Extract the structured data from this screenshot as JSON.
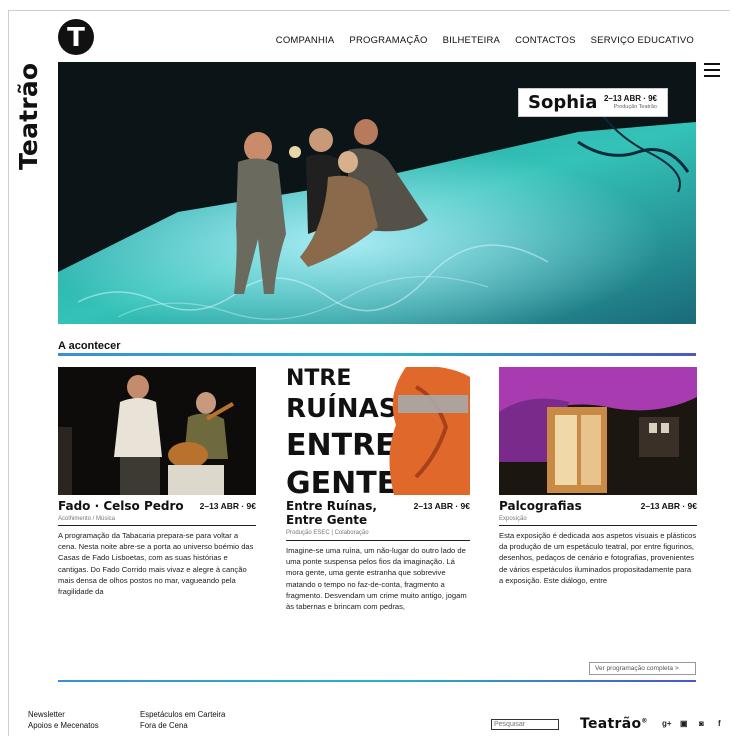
{
  "brand": {
    "name": "Teatrão",
    "logo_letter": "T"
  },
  "nav": {
    "items": [
      "COMPANHIA",
      "PROGRAMAÇÃO",
      "BILHETEIRA",
      "CONTACTOS",
      "SERVIÇO EDUCATIVO"
    ]
  },
  "menu_icon": "hamburger-menu-icon",
  "hero": {
    "title": "Sophia",
    "date": "2–13 ABR · 9€",
    "subtitle": "Produção Teatrão"
  },
  "section": {
    "title": "A acontecer"
  },
  "cards": [
    {
      "title": "Fado · Celso Pedro",
      "date": "2–13 ABR · 9€",
      "category": "Acolhimento / Música",
      "text": "A programação da Tabacaria prepara-se para voltar a cena. Nesta noite abre-se a porta ao universo boémio das Casas de Fado Lisboetas, com as suas histórias e cantigas. Do Fado Corrido mais vivaz e alegre à canção mais densa de olhos postos no mar, vagueando pela fragilidade da"
    },
    {
      "title": "Entre Ruínas, Entre Gente",
      "date": "2–13 ABR · 9€",
      "category": "Produção ESEC | Colaboração",
      "text": "Imagine-se uma ruína, um não-lugar do outro lado de uma ponte suspensa pelos fios da imaginação. Lá mora gente, uma gente estranha que sobrevive matando o tempo no faz-de-conta, fragmento a fragmento. Desvendam um crime muito antigo, jogam às tabernas e brincam com pedras,",
      "poster_text": [
        "NTRE",
        "RUÍNAS,",
        "ENTRE",
        "GENTE"
      ]
    },
    {
      "title": "Palcografias",
      "date": "2–13 ABR · 9€",
      "category": "Exposição",
      "text": "Esta exposição é dedicada aos aspetos visuais e plásticos da produção de um espetáculo teatral, por entre figurinos, desenhos, pedaços de cenário e fotografias, provenientes de vários espetáculos iluminados propositadamente para a exposição. Este diálogo, entre"
    }
  ],
  "more_button": "Ver programação completa  >",
  "footer": {
    "col1": [
      "Newsletter",
      "Apoios e Mecenatos"
    ],
    "col2": [
      "Espetáculos em Carteira",
      "Fora de Cena"
    ],
    "search_placeholder": "Pesquisar",
    "brand": "Teatrão",
    "brand_mark": "®",
    "social": [
      {
        "icon": "google-plus-icon",
        "glyph": "g+"
      },
      {
        "icon": "youtube-icon",
        "glyph": "▣"
      },
      {
        "icon": "instagram-icon",
        "glyph": "◙"
      },
      {
        "icon": "facebook-icon",
        "glyph": "f"
      }
    ]
  }
}
